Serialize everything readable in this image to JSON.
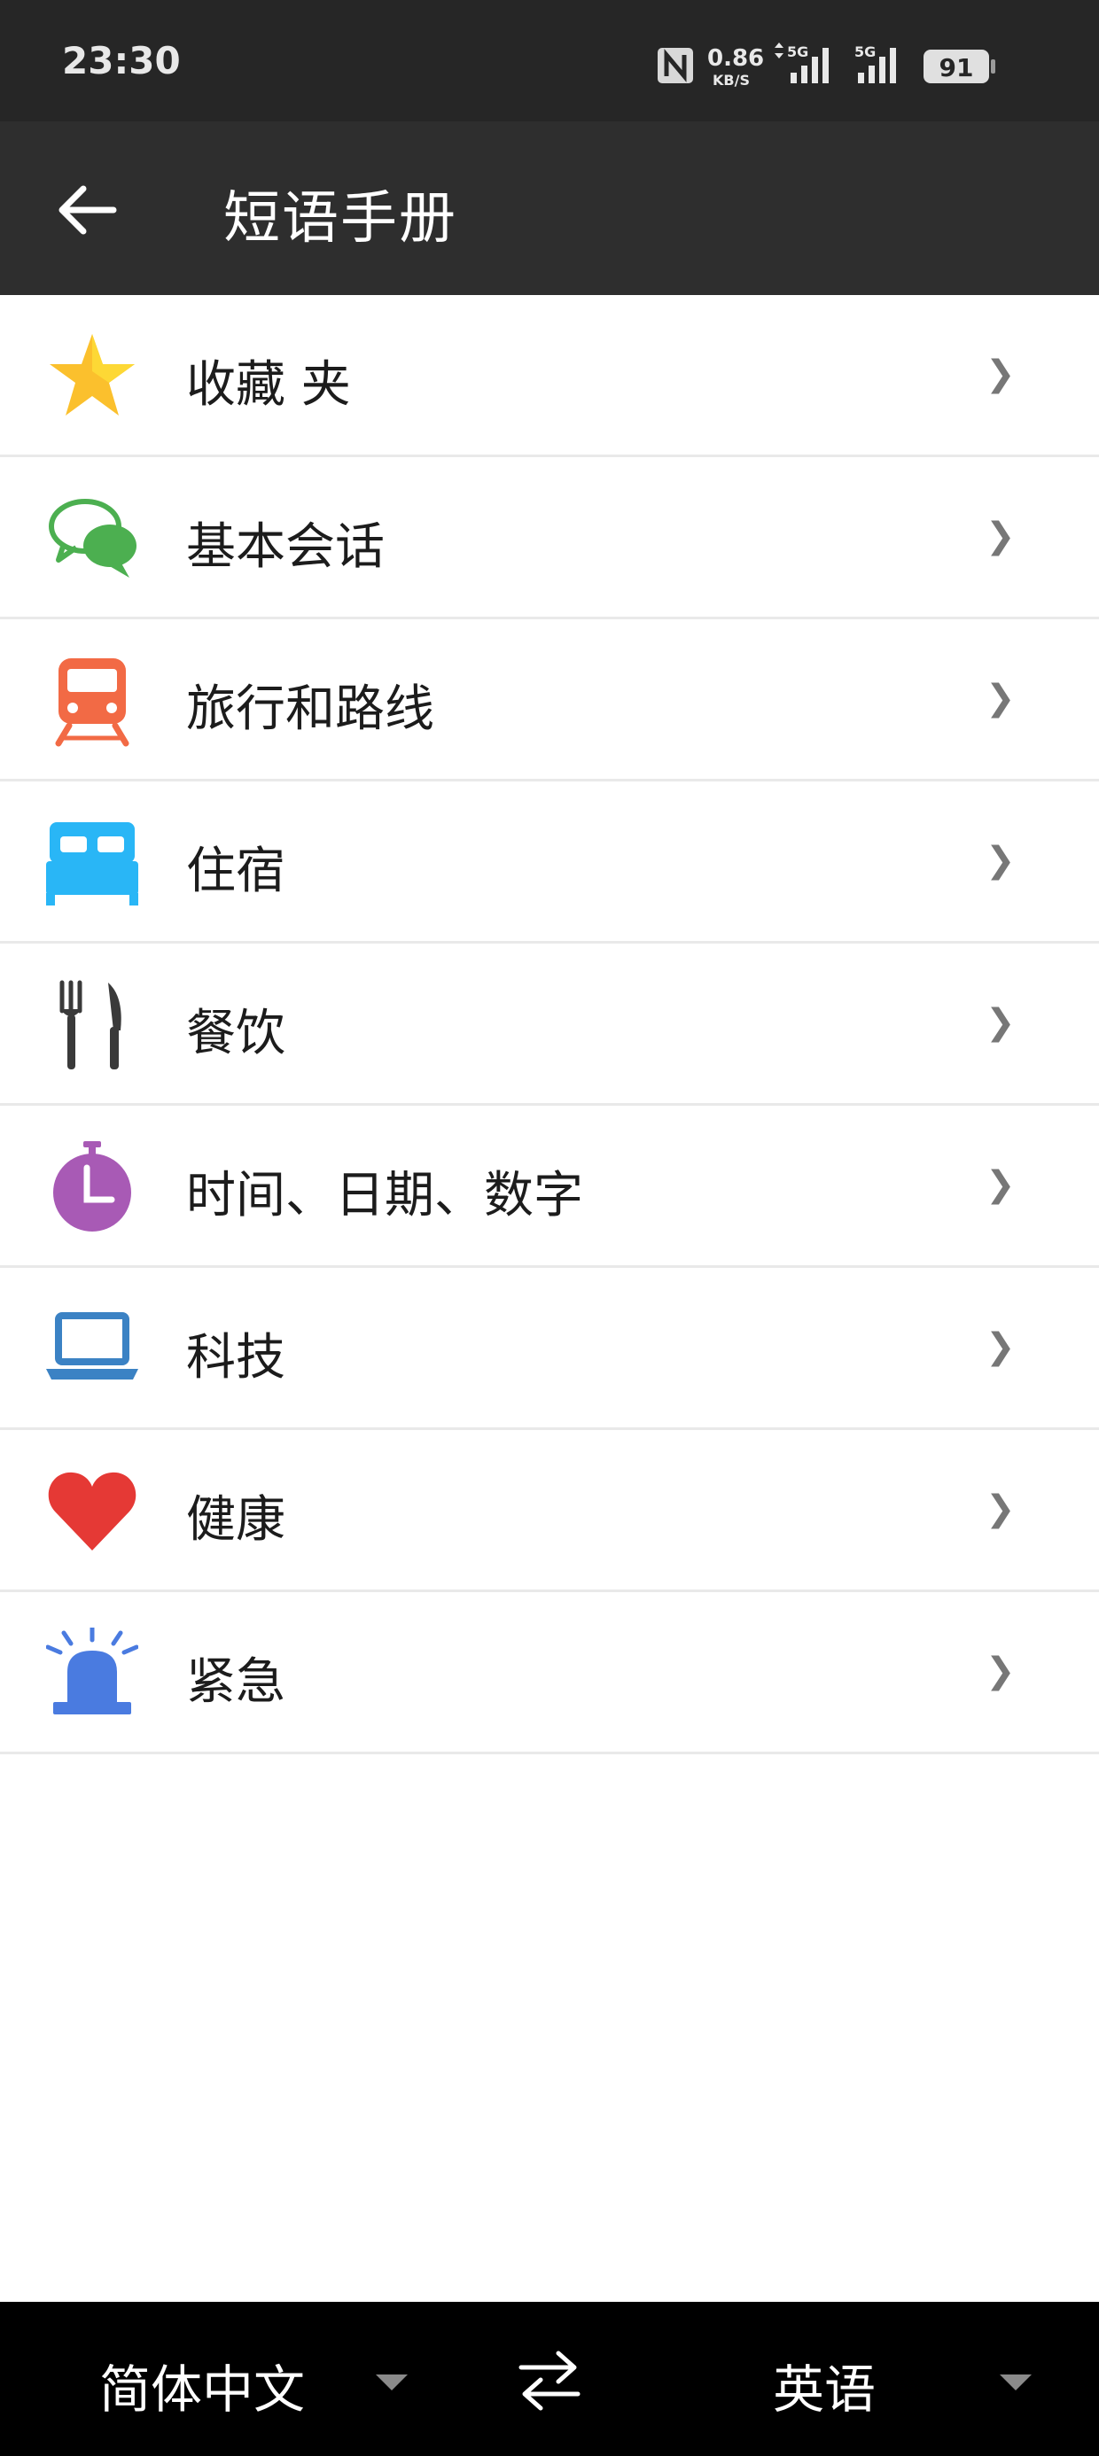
{
  "status_bar": {
    "time": "23:30",
    "net_speed_value": "0.86",
    "net_speed_unit": "KB/S",
    "signal_1_label": "5G",
    "signal_2_label": "5G",
    "battery": "91",
    "icons": [
      "nfc-icon",
      "data-arrows-icon",
      "signal-icon",
      "signal-icon",
      "battery-icon"
    ]
  },
  "app_bar": {
    "title": "短语手册",
    "back_icon": "arrow-left-icon"
  },
  "categories": [
    {
      "label": "收藏 夹",
      "icon": "star-icon",
      "color": "#FBC02D"
    },
    {
      "label": "基本会话",
      "icon": "chat-bubbles-icon",
      "color": "#4CAF50"
    },
    {
      "label": "旅行和路线",
      "icon": "train-icon",
      "color": "#F26A45"
    },
    {
      "label": "住宿",
      "icon": "bed-icon",
      "color": "#29B6F6"
    },
    {
      "label": "餐饮",
      "icon": "fork-knife-icon",
      "color": "#3a3a3a"
    },
    {
      "label": "时间、日期、数字",
      "icon": "stopwatch-icon",
      "color": "#A85AB5"
    },
    {
      "label": "科技",
      "icon": "laptop-icon",
      "color": "#3B82C4"
    },
    {
      "label": "健康",
      "icon": "heart-icon",
      "color": "#E53935"
    },
    {
      "label": "紧急",
      "icon": "siren-icon",
      "color": "#4A7BE0"
    }
  ],
  "chevron_glyph": "❯",
  "bottom_bar": {
    "source_language": "简体中文",
    "target_language": "英语",
    "swap_icon": "swap-arrows-icon"
  }
}
